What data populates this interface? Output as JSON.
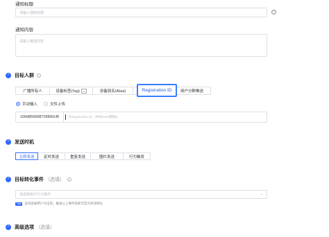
{
  "notify_title": {
    "label": "通知标题",
    "placeholder": "请输入通知标题"
  },
  "notify_content": {
    "label": "通知内容",
    "placeholder": "请输入推送内容"
  },
  "audience": {
    "title": "目标人群",
    "tabs": [
      "广播所有人",
      "设备标签(Tag)",
      "设备别名(Alias)",
      "Registration ID",
      "用户分群推送"
    ],
    "input_modes": [
      "手动输入",
      "文件上传"
    ],
    "reg_id_value": "100d855908726892cf6",
    "reg_id_placeholder": "在Registration ID，并按Enter键确认"
  },
  "send_time": {
    "title": "发送时机",
    "options": [
      "立即发送",
      "定时发送",
      "重复发送",
      "围栏发送",
      "行为触发"
    ]
  },
  "conversion": {
    "title": "目标转化事件",
    "subtitle": "（选填）",
    "placeholder": "请选择用户行为事件",
    "badge": "Tips",
    "hint": "该消息被用户点击后，触发以上事件后即可定为有效转化"
  },
  "advanced": {
    "title": "高级选项",
    "subtitle": "（选填）"
  },
  "icons": {
    "section": "chevron-up-icon",
    "help": "question-circle-icon",
    "emoji": "smile-icon"
  },
  "colors": {
    "primary": "#2f6bff",
    "highlight": "#3a7bff"
  }
}
